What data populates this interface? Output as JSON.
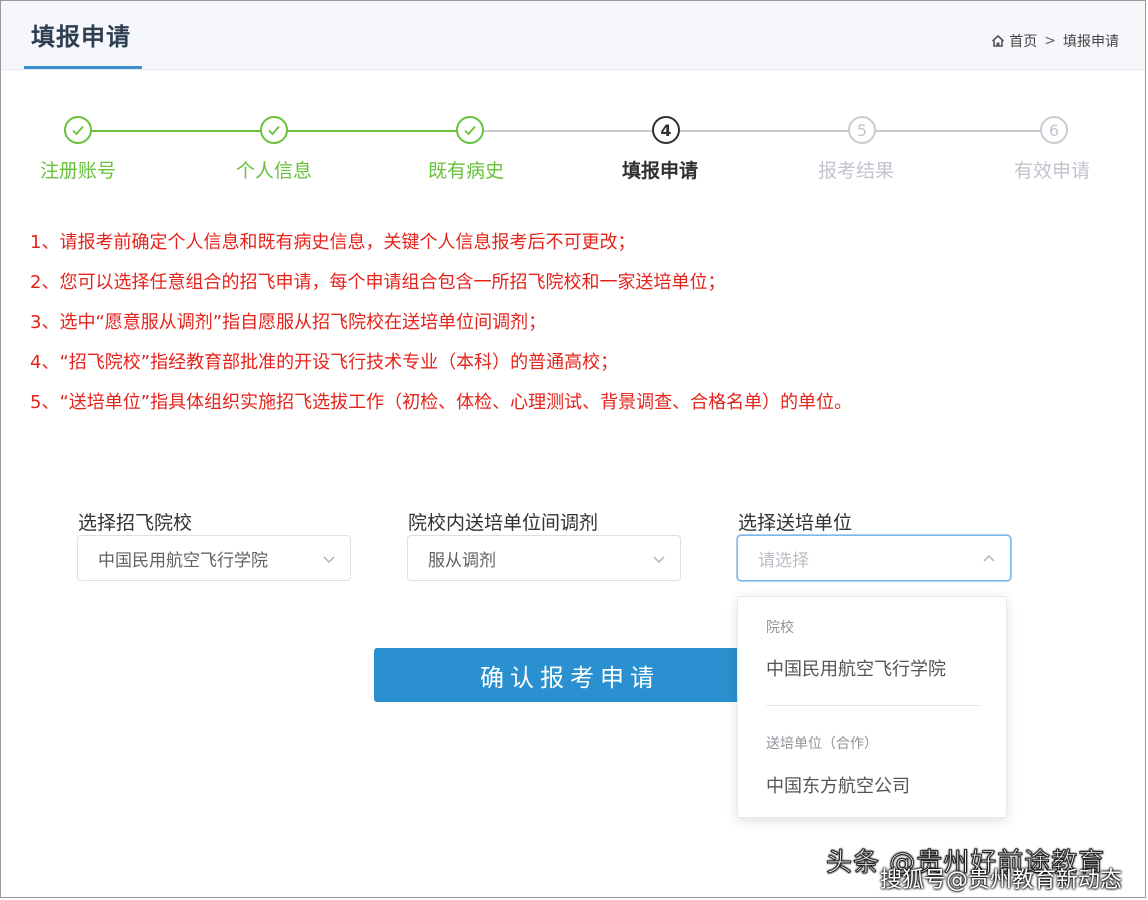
{
  "header": {
    "title": "填报申请",
    "breadcrumb": {
      "home": "首页",
      "separator": ">",
      "current": "填报申请"
    }
  },
  "steps": [
    {
      "number": "1",
      "label": "注册账号",
      "status": "done"
    },
    {
      "number": "2",
      "label": "个人信息",
      "status": "done"
    },
    {
      "number": "3",
      "label": "既有病史",
      "status": "done"
    },
    {
      "number": "4",
      "label": "填报申请",
      "status": "current"
    },
    {
      "number": "5",
      "label": "报考结果",
      "status": "todo"
    },
    {
      "number": "6",
      "label": "有效申请",
      "status": "todo"
    }
  ],
  "notes": [
    "1、请报考前确定个人信息和既有病史信息，关键个人信息报考后不可更改；",
    "2、您可以选择任意组合的招飞申请，每个申请组合包含一所招飞院校和一家送培单位；",
    "3、选中“愿意服从调剂”指自愿服从招飞院校在送培单位间调剂；",
    "4、“招飞院校”指经教育部批准的开设飞行技术专业（本科）的普通高校；",
    "5、“送培单位”指具体组织实施招飞选拔工作（初检、体检、心理测试、背景调查、合格名单）的单位。"
  ],
  "form": {
    "school": {
      "label": "选择招飞院校",
      "value": "中国民用航空飞行学院"
    },
    "adjust": {
      "label": "院校内送培单位间调剂",
      "value": "服从调剂"
    },
    "unit": {
      "label": "选择送培单位",
      "placeholder": "请选择"
    }
  },
  "dropdown": {
    "group1_title": "院校",
    "group1_option": "中国民用航空飞行学院",
    "group2_title": "送培单位（合作）",
    "group2_option": "中国东方航空公司"
  },
  "confirm_label": "确认报考申请",
  "watermark": {
    "line1": "头条 @贵州好前途教育",
    "line2": "搜狐号@贵州教育新动态"
  },
  "colors": {
    "done": "#67c23a",
    "current": "#303133",
    "todo": "#c0c4cc",
    "note_red": "#e5231b",
    "primary": "#2a90d0"
  }
}
